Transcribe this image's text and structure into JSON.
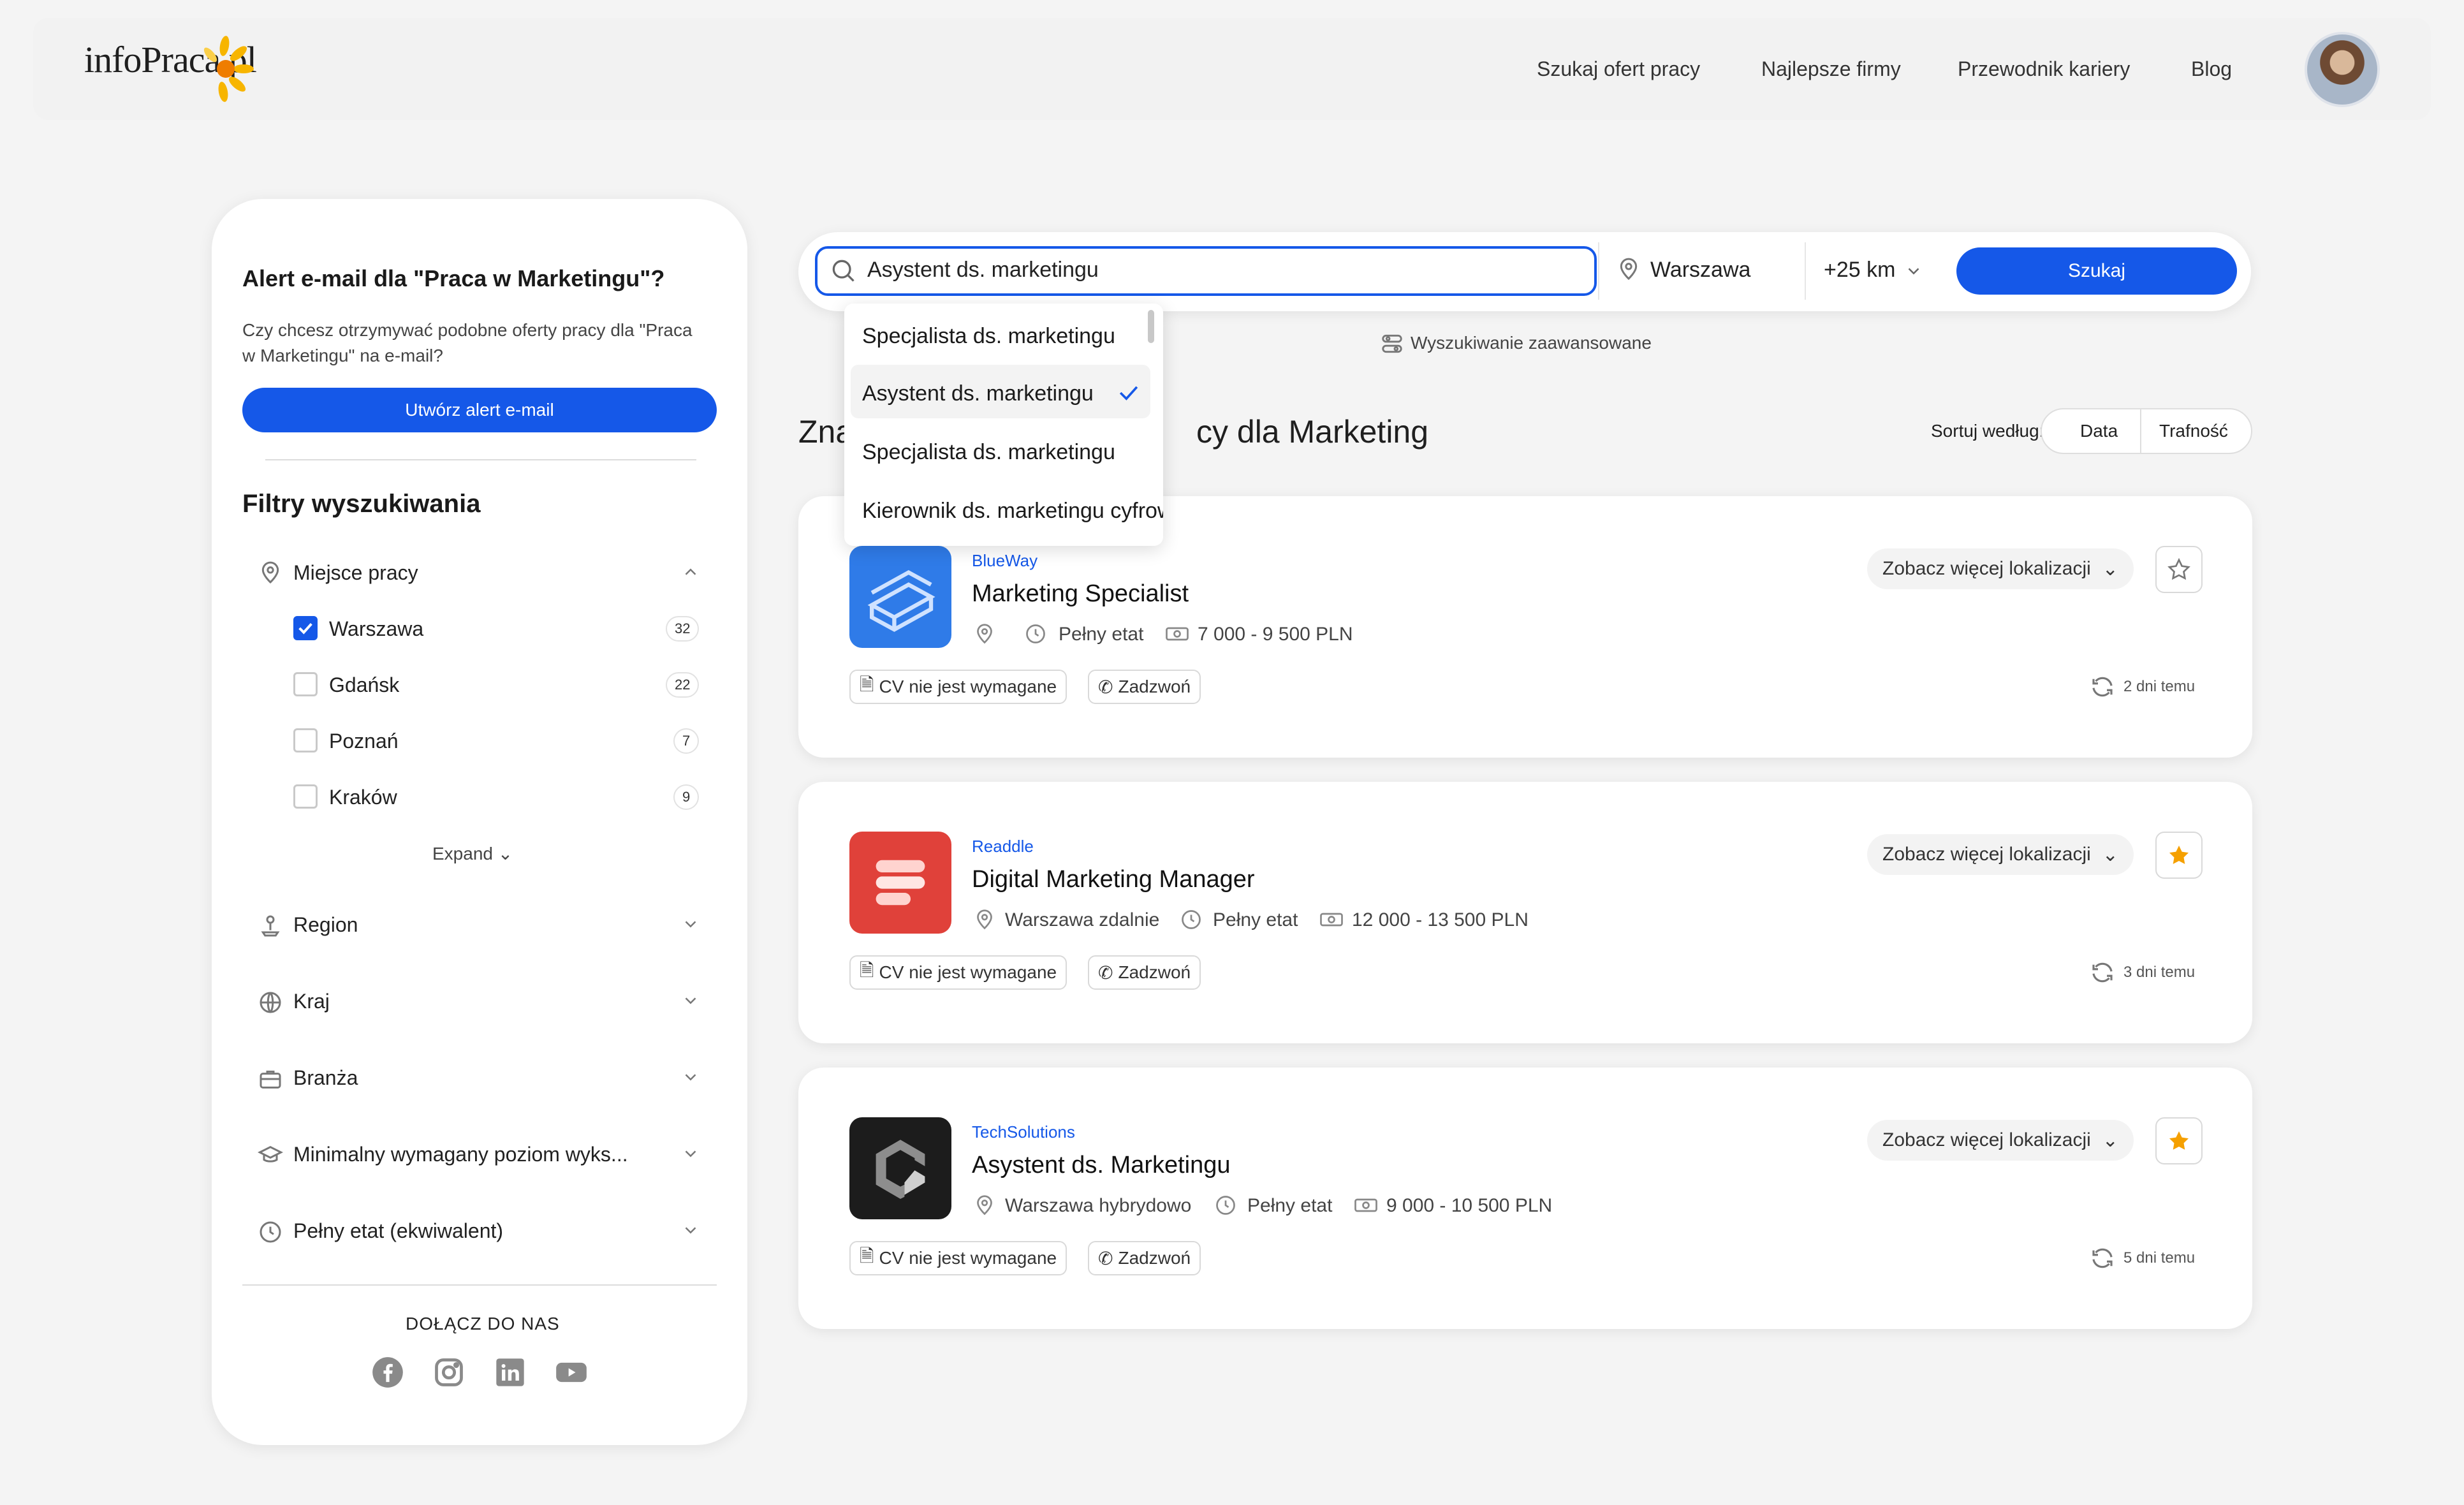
{
  "header": {
    "logo": "infoPraca.pl",
    "nav": [
      "Szukaj ofert pracy",
      "Najlepsze firmy",
      "Przewodnik kariery",
      "Blog"
    ]
  },
  "sidebar": {
    "alert_title": "Alert e-mail dla \"Praca w Marketingu\"?",
    "alert_desc": "Czy chcesz otrzymywać podobne oferty pracy dla \"Praca w Marketingu\" na e-mail?",
    "alert_button": "Utwórz alert e-mail",
    "filters_title": "Filtry wyszukiwania",
    "location_section": "Miejsce pracy",
    "cities": [
      {
        "name": "Warszawa",
        "count": "32",
        "checked": true
      },
      {
        "name": "Gdańsk",
        "count": "22",
        "checked": false
      },
      {
        "name": "Poznań",
        "count": "7",
        "checked": false
      },
      {
        "name": "Kraków",
        "count": "9",
        "checked": false
      }
    ],
    "expand": "Expand",
    "sections": [
      "Region",
      "Kraj",
      "Branża",
      "Minimalny wymagany poziom wyks...",
      "Pełny etat (ekwiwalent)"
    ],
    "join_label": "DOŁĄCZ DO NAS",
    "socials": [
      "facebook-icon",
      "instagram-icon",
      "linkedin-icon",
      "youtube-icon"
    ]
  },
  "search": {
    "query": "Asystent ds. marketingu",
    "location": "Warszawa",
    "radius": "+25 km",
    "button": "Szukaj",
    "advanced": "Wyszukiwanie zaawansowane",
    "suggestions": [
      "Specjalista ds. marketingu",
      "Asystent ds. marketingu",
      "Specjalista ds. marketingu",
      "Kierownik ds. marketingu cyfrowego"
    ],
    "selected_suggestion": 1
  },
  "results": {
    "title_left": "Zna",
    "title_right": "cy dla Marketing",
    "sort_label": "Sortuj według:",
    "sort_options": [
      "Data",
      "Trafność"
    ]
  },
  "jobs": [
    {
      "company": "BlueWay",
      "title": "Marketing Specialist",
      "location": "",
      "type": "Pełny etat",
      "salary": "7 000 - 9 500 PLN",
      "tags": [
        "CV nie jest wymagane",
        "Zadzwoń"
      ],
      "more_loc": "Zobacz więcej lokalizacji",
      "starred": false,
      "time": "2 dni temu",
      "logo_color": "#2f7be8"
    },
    {
      "company": "Readdle",
      "title": "Digital Marketing Manager",
      "location": "Warszawa zdalnie",
      "type": "Pełny etat",
      "salary": "12 000 - 13 500 PLN",
      "tags": [
        "CV nie jest wymagane",
        "Zadzwoń"
      ],
      "more_loc": "Zobacz więcej lokalizacji",
      "starred": true,
      "time": "3 dni temu",
      "logo_color": "#e0413a"
    },
    {
      "company": "TechSolutions",
      "title": "Asystent ds. Marketingu",
      "location": "Warszawa hybrydowo",
      "type": "Pełny etat",
      "salary": "9 000 - 10 500 PLN",
      "tags": [
        "CV nie jest wymagane",
        "Zadzwoń"
      ],
      "more_loc": "Zobacz więcej lokalizacji",
      "starred": true,
      "time": "5 dni temu",
      "logo_color": "#1c1c1c"
    }
  ],
  "colors": {
    "accent": "#1558e8",
    "star": "#f5a000",
    "background": "#f4f4f4"
  }
}
